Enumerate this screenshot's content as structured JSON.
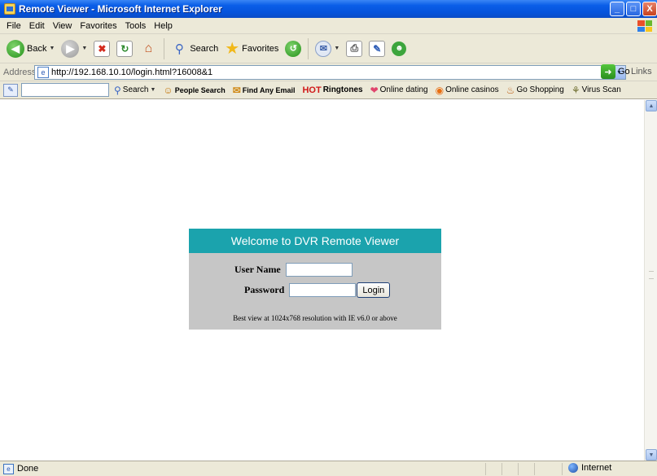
{
  "window": {
    "title": "Remote Viewer - Microsoft Internet Explorer",
    "minimize": "_",
    "maximize": "□",
    "close": "X"
  },
  "menu": [
    "File",
    "Edit",
    "View",
    "Favorites",
    "Tools",
    "Help"
  ],
  "toolbar": {
    "back": "Back",
    "search": "Search",
    "favorites": "Favorites"
  },
  "address": {
    "label": "Address",
    "url": "http://192.168.10.10/login.html?16008&1",
    "go": "Go",
    "links": "Links"
  },
  "linksbar": {
    "search": "Search",
    "people_search": "People Search",
    "find_email": "Find Any Email",
    "hot": "HOT",
    "ringtones": "Ringtones",
    "dating": "Online dating",
    "casinos": "Online casinos",
    "shopping": "Go Shopping",
    "virus": "Virus Scan"
  },
  "login": {
    "header": "Welcome to DVR Remote Viewer",
    "user_label": "User Name",
    "password_label": "Password",
    "button": "Login",
    "note": "Best view at 1024x768 resolution with IE v6.0 or above"
  },
  "status": {
    "text": "Done",
    "zone": "Internet"
  },
  "colors": {
    "header_teal": "#1BA3AD",
    "panel_gray": "#C6C6C6",
    "xp_blue": "#0553DC"
  }
}
